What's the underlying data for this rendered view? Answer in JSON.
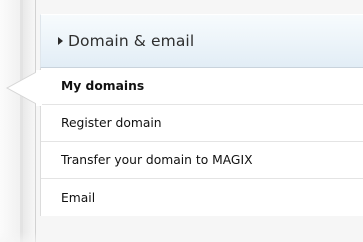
{
  "section": {
    "title": "Domain & email",
    "icon": "caret-right-icon"
  },
  "menu": {
    "items": [
      {
        "label": "My domains",
        "active": true
      },
      {
        "label": "Register domain",
        "active": false
      },
      {
        "label": "Transfer your domain to MAGIX",
        "active": false
      },
      {
        "label": "Email",
        "active": false
      }
    ]
  },
  "colors": {
    "header_gradient_top": "#f7fbfd",
    "header_gradient_bottom": "#e2edf6",
    "menu_background": "#ffffff",
    "text": "#111111",
    "page_background": "#f6f6f6"
  }
}
